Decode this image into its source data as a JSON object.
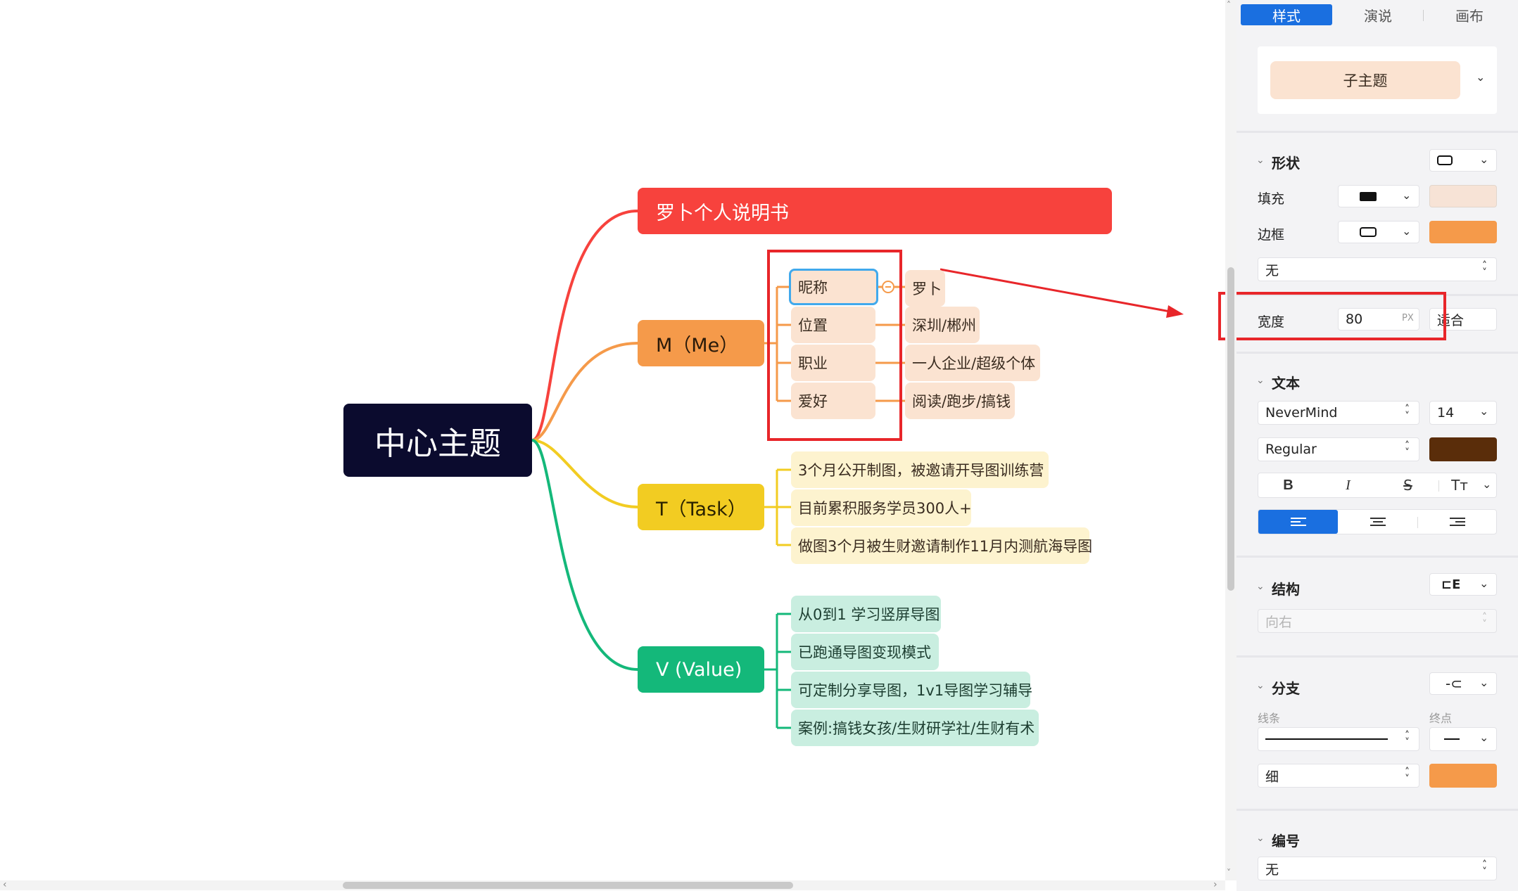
{
  "mindmap": {
    "central": "中心主题",
    "branches": {
      "title": "罗卜个人说明书",
      "me": "M（Me）",
      "task": "T（Task）",
      "value": "V (Value)"
    },
    "me_items": [
      {
        "key": "昵称",
        "value": "罗卜"
      },
      {
        "key": "位置",
        "value": "深圳/郴州"
      },
      {
        "key": "职业",
        "value": "一人企业/超级个体"
      },
      {
        "key": "爱好",
        "value": "阅读/跑步/搞钱"
      }
    ],
    "task_items": [
      "3个月公开制图，被邀请开导图训练营",
      "目前累积服务学员300人+",
      "做图3个月被生财邀请制作11月内测航海导图"
    ],
    "value_items": [
      "从0到1 学习竖屏导图",
      "已跑通导图变现模式",
      "可定制分享导图，1v1导图学习辅导",
      "案例:搞钱女孩/生财研学社/生财有术"
    ],
    "colors": {
      "title": "#f7423d",
      "me": "#f59a4a",
      "task": "#f2cc22",
      "value": "#14b87a",
      "central": "#0b0b2e",
      "annotation": "#e8262a"
    }
  },
  "panel": {
    "tabs": [
      "样式",
      "演说",
      "画布"
    ],
    "active_tab": "样式",
    "topic_style": "子主题",
    "shape": {
      "section": "形状",
      "fill_label": "填充",
      "fill_color": "#f7e3d6",
      "border_label": "边框",
      "border_color": "#f59a4a",
      "none": "无",
      "width_label": "宽度",
      "width_value": "80",
      "width_unit": "PX",
      "fit": "适合"
    },
    "text": {
      "section": "文本",
      "font": "NeverMind",
      "size": "14",
      "weight": "Regular",
      "color": "#5a2d0a",
      "bold": "B",
      "italic": "I",
      "strike": "S",
      "case": "Tт"
    },
    "structure": {
      "section": "结构",
      "direction": "向右"
    },
    "branch": {
      "section": "分支",
      "line_label": "线条",
      "end_label": "终点",
      "thickness": "细",
      "color": "#f59a4a"
    },
    "numbering": {
      "section": "编号",
      "value": "无"
    }
  }
}
